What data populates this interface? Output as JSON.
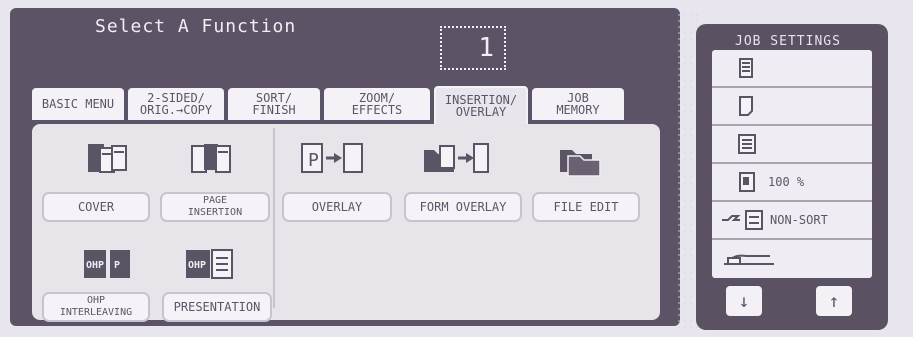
{
  "header": {
    "title": "Select A Function",
    "copy_count": "1"
  },
  "tabs": [
    {
      "id": "basic",
      "label1": "BASIC MENU",
      "label2": ""
    },
    {
      "id": "two_sided",
      "label1": "2-SIDED/",
      "label2": "ORIG.→COPY"
    },
    {
      "id": "sort",
      "label1": "SORT/",
      "label2": "FINISH"
    },
    {
      "id": "zoom",
      "label1": "ZOOM/",
      "label2": "EFFECTS"
    },
    {
      "id": "insertion",
      "label1": "INSERTION/",
      "label2": "OVERLAY",
      "active": true
    },
    {
      "id": "job",
      "label1": "JOB",
      "label2": "MEMORY"
    }
  ],
  "functions": {
    "cover": {
      "label": "COVER"
    },
    "page_insertion": {
      "label1": "PAGE",
      "label2": "INSERTION"
    },
    "overlay": {
      "label": "OVERLAY"
    },
    "form_overlay": {
      "label": "FORM OVERLAY"
    },
    "file_edit": {
      "label": "FILE EDIT"
    },
    "ohp_interleaving": {
      "label1": "OHP",
      "label2": "INTERLEAVING"
    },
    "presentation": {
      "label": "PRESENTATION"
    }
  },
  "sidebar": {
    "title": "JOB SETTINGS",
    "rows": [
      {
        "icon": "two-sided-original-icon",
        "text": ""
      },
      {
        "icon": "single-sheet-icon",
        "text": ""
      },
      {
        "icon": "text-page-icon",
        "text": ""
      },
      {
        "icon": "zoom-page-icon",
        "text": "100 %"
      },
      {
        "icon": "sort-icon",
        "text": "NON-SORT"
      },
      {
        "icon": "tray-icon",
        "text": ""
      }
    ],
    "down_arrow": "↓",
    "up_arrow": "↑"
  }
}
